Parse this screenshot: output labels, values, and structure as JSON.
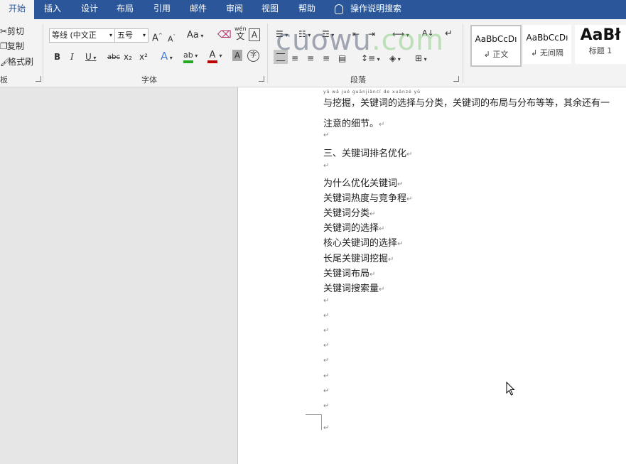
{
  "tabs": [
    "开始",
    "插入",
    "设计",
    "布局",
    "引用",
    "邮件",
    "审阅",
    "视图",
    "帮助"
  ],
  "tell_me": "操作说明搜索",
  "clipboard": {
    "cut": "剪切",
    "copy": "复制",
    "format_painter": "格式刷",
    "group": "板"
  },
  "font": {
    "name": "等线 (中文正",
    "size": "五号",
    "grow": "A",
    "shrink": "A",
    "case": "Aa",
    "phonetic": "wén",
    "phonetic_char": "文",
    "border_char": "A",
    "bold": "B",
    "italic": "I",
    "underline": "U",
    "strike": "abc",
    "sub": "x₂",
    "sup": "x²",
    "effect": "A",
    "highlight": "ab",
    "color": "A",
    "shade": "A",
    "enclose": "字",
    "group": "字体"
  },
  "paragraph": {
    "group": "段落",
    "sort": "A↓",
    "marks": "↵"
  },
  "styles": [
    {
      "sample": "AaBbCcDı",
      "name": "↲ 正文"
    },
    {
      "sample": "AaBbCcDı",
      "name": "↲ 无间隔"
    },
    {
      "sample": "AaBł",
      "name": "标题 1"
    }
  ],
  "watermark": {
    "part1": "cuowu",
    "part2": ".com"
  },
  "document": {
    "ruby": "yǔ wā jué      guānjiàncí de xuǎnzé yǔ",
    "line1": "与挖掘，关键词的选择与分类，关键词的布局与分布等等，其余还有一",
    "line2": "注意的细节。",
    "heading": "三、关键词排名优化",
    "items": [
      "为什么优化关键词",
      "关键词热度与竞争程",
      "关键词分类",
      "关键词的选择",
      "核心关键词的选择",
      "长尾关键词挖掘",
      "关键词布局",
      "关键词搜索量"
    ],
    "para_mark": "↵"
  },
  "colors": {
    "accent": "#2b579a",
    "highlight": "#22aa22",
    "font_color": "#c00000"
  }
}
